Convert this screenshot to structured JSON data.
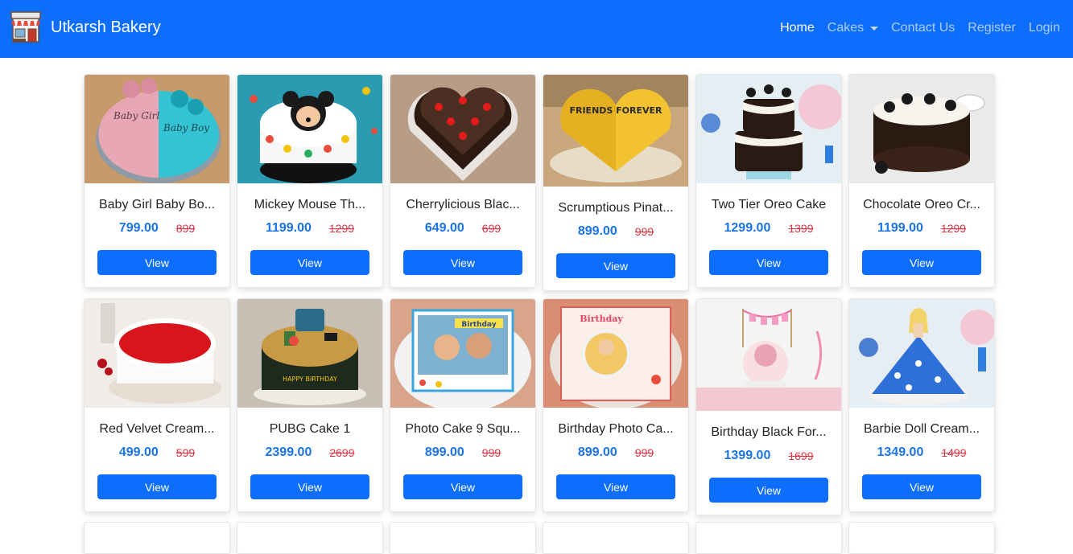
{
  "brand": {
    "name": "Utkarsh Bakery",
    "logo_icon": "bakery-shop-icon"
  },
  "nav": {
    "items": [
      {
        "label": "Home",
        "active": true
      },
      {
        "label": "Cakes",
        "dropdown": true
      },
      {
        "label": "Contact Us"
      },
      {
        "label": "Register"
      },
      {
        "label": "Login"
      }
    ]
  },
  "colors": {
    "primary": "#0d6efd",
    "price": "#1a73e8",
    "old_price": "#dc3545"
  },
  "products": [
    {
      "title": "Baby Girl Baby Bo...",
      "price": "799.00",
      "old_price": "899",
      "button": "View"
    },
    {
      "title": "Mickey Mouse Th...",
      "price": "1199.00",
      "old_price": "1299",
      "button": "View"
    },
    {
      "title": "Cherrylicious Blac...",
      "price": "649.00",
      "old_price": "699",
      "button": "View"
    },
    {
      "title": "Scrumptious Pinat...",
      "price": "899.00",
      "old_price": "999",
      "button": "View"
    },
    {
      "title": "Two Tier Oreo Cake",
      "price": "1299.00",
      "old_price": "1399",
      "button": "View"
    },
    {
      "title": "Chocolate Oreo Cr...",
      "price": "1199.00",
      "old_price": "1299",
      "button": "View"
    },
    {
      "title": "Red Velvet Cream...",
      "price": "499.00",
      "old_price": "599",
      "button": "View"
    },
    {
      "title": "PUBG Cake 1",
      "price": "2399.00",
      "old_price": "2699",
      "button": "View"
    },
    {
      "title": "Photo Cake 9 Squ...",
      "price": "899.00",
      "old_price": "999",
      "button": "View"
    },
    {
      "title": "Birthday Photo Ca...",
      "price": "899.00",
      "old_price": "999",
      "button": "View"
    },
    {
      "title": "Birthday Black For...",
      "price": "1399.00",
      "old_price": "1699",
      "button": "View"
    },
    {
      "title": "Barbie Doll Cream...",
      "price": "1349.00",
      "old_price": "1499",
      "button": "View"
    }
  ],
  "image_texts": {
    "friends_forever": "FRIENDS FOREVER",
    "baby_girl": "Baby Girl",
    "baby_boy": "Baby Boy",
    "birthday": "Birthday",
    "happy_birthday": "HAPPY BIRTHDAY"
  }
}
